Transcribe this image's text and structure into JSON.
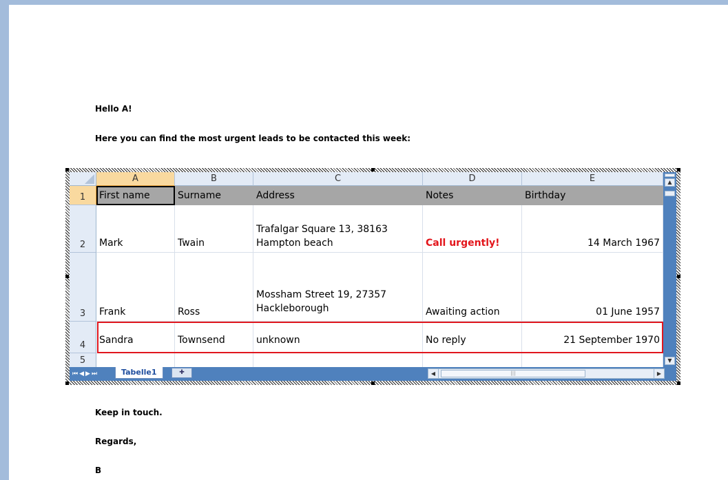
{
  "document": {
    "greeting": "Hello A!",
    "intro": "Here you can find the most urgent leads to be contacted this week:",
    "closing": "Keep in touch.",
    "regards": "Regards,",
    "signature": "B"
  },
  "sheet": {
    "columns": [
      "A",
      "B",
      "C",
      "D",
      "E"
    ],
    "row_numbers": [
      "1",
      "2",
      "3",
      "4",
      "5"
    ],
    "header": [
      "First name",
      "Surname",
      "Address",
      "Notes",
      "Birthday"
    ],
    "rows": [
      {
        "first": "Mark",
        "surname": "Twain",
        "address": "Trafalgar Square 13, 38163 Hampton beach",
        "notes": "Call urgently!",
        "birthday": "14 March 1967"
      },
      {
        "first": "Frank",
        "surname": "Ross",
        "address": "Mossham Street 19, 27357 Hackleborough",
        "notes": "Awaiting action",
        "birthday": "01 June 1957"
      },
      {
        "first": "Sandra",
        "surname": "Townsend",
        "address": "unknown",
        "notes": "No reply",
        "birthday": "21 September 1970"
      }
    ],
    "tab_label": "Tabelle1",
    "urgent_color": "#e3151b",
    "highlight_border_color": "#e0161d"
  }
}
